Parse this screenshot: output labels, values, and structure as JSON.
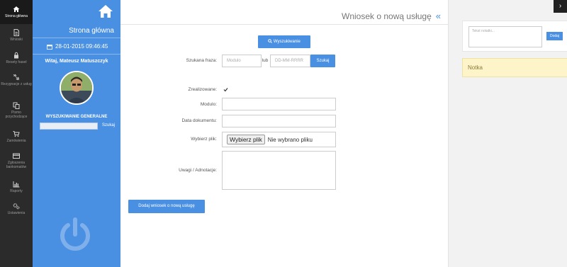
{
  "nav": {
    "items": [
      {
        "label": "Strona główna",
        "icon": "home-icon",
        "active": true
      },
      {
        "label": "Wnioski",
        "icon": "document-icon",
        "active": false
      },
      {
        "label": "Resety haseł",
        "icon": "lock-icon",
        "active": false
      },
      {
        "label": "Rezygnacje z usług",
        "icon": "unlink-icon",
        "active": false
      },
      {
        "label": "Pismo przychodzące",
        "icon": "copy-icon",
        "active": false
      },
      {
        "label": "Zamówienia",
        "icon": "cart-icon",
        "active": false
      },
      {
        "label": "Zgłoszenia bankomatów",
        "icon": "card-icon",
        "active": false
      },
      {
        "label": "Raporty",
        "icon": "bar-chart-icon",
        "active": false
      },
      {
        "label": "Ustawienia",
        "icon": "gears-icon",
        "active": false
      }
    ]
  },
  "panel": {
    "title": "Strona główna",
    "datetime": "28-01-2015 09:46:45",
    "greeting": "Witaj, Mateusz Matuszczyk",
    "global_search_label": "WYSZUKIWANIE GENERALNE",
    "global_search_value": "",
    "global_search_button": "Szukaj"
  },
  "main": {
    "page_title": "Wniosek o nową usługę",
    "search_button": "Wyszukiwanie",
    "search_phrase_label": "Szukana fraza:",
    "modulo_placeholder": "Modulo",
    "or_label": "lub",
    "date_placeholder": "DD-MM-RRRR",
    "find_button": "Szukaj",
    "realized_label": "Zrealizowane:",
    "realized_checked": true,
    "modulo_label": "Modulo:",
    "doc_date_label": "Data dokumentu:",
    "file_label": "Wybierz plik:",
    "file_button": "Wybierz plik",
    "file_status": "Nie wybrano pliku",
    "notes_label": "Uwagi / Adnotacje:",
    "submit_button": "Dodaj wniosek o nową usługę"
  },
  "right": {
    "note_placeholder": "Tekst notatki...",
    "note_add_button": "Dodaj",
    "note_header": "Notka"
  },
  "colors": {
    "accent": "#4a90e2",
    "nav_bg": "#2b2b2b",
    "note_bg": "#fdf4c9"
  }
}
